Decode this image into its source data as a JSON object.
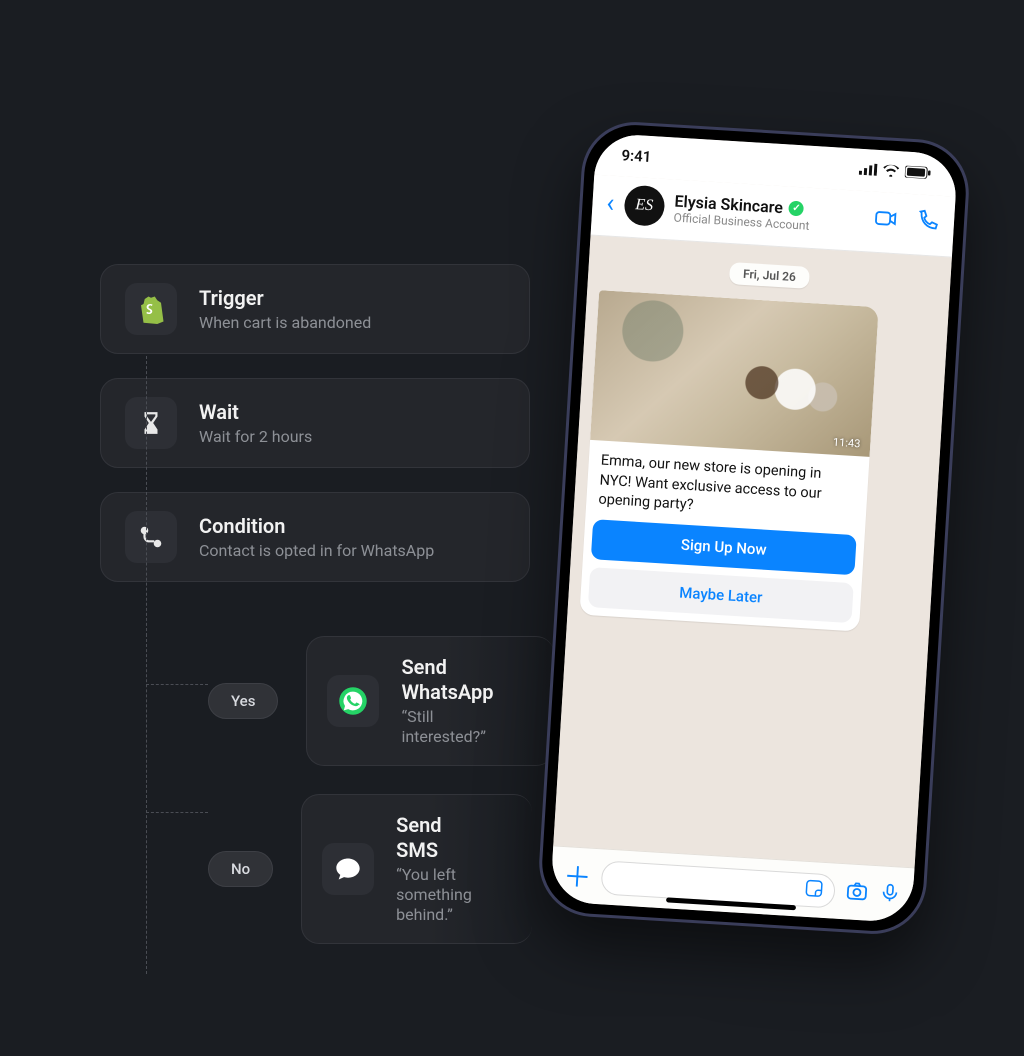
{
  "workflow": {
    "trigger": {
      "icon": "shopify",
      "title": "Trigger",
      "subtitle": "When cart is abandoned"
    },
    "wait": {
      "icon": "hourglass",
      "title": "Wait",
      "subtitle": "Wait for 2 hours"
    },
    "condition": {
      "icon": "branch",
      "title": "Condition",
      "subtitle": "Contact is opted in for WhatsApp"
    },
    "branches": {
      "yes": {
        "label": "Yes",
        "icon": "whatsapp",
        "title": "Send WhatsApp",
        "subtitle": "“Still interested?”"
      },
      "no": {
        "label": "No",
        "icon": "sms",
        "title": "Send SMS",
        "subtitle": "“You left something behind.”"
      }
    }
  },
  "phone": {
    "status": {
      "time": "9:41"
    },
    "header": {
      "avatar_initials": "ES",
      "name": "Elysia Skincare",
      "subtitle": "Official Business Account"
    },
    "chat": {
      "date": "Fri, Jul 26",
      "message_text": "Emma, our new store is opening in NYC! Want exclusive access to our opening party?",
      "message_time": "11:43",
      "button_primary": "Sign Up Now",
      "button_secondary": "Maybe Later"
    }
  }
}
